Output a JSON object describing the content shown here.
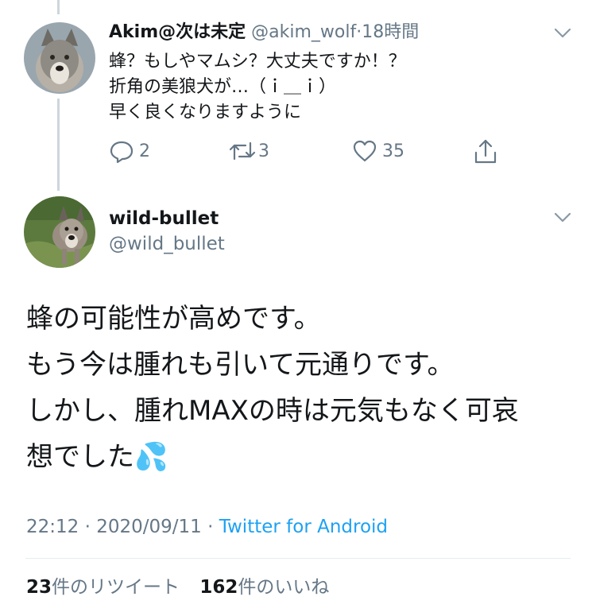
{
  "reply": {
    "display_name": "Akim@次は未定",
    "handle": "@akim_wolf",
    "separator": "·",
    "time": "18時間",
    "lines": [
      "蜂？もしやマムシ？大丈夫ですか！？",
      "折角の美狼犬が…（ｉ＿ｉ）",
      "早く良くなりますように"
    ],
    "actions": {
      "replies": "2",
      "retweets": "3",
      "likes": "35"
    }
  },
  "main_tweet": {
    "display_name": "wild-bullet",
    "handle": "@wild_bullet",
    "lines": [
      "蜂の可能性が高めです。",
      "もう今は腫れも引いて元通りです。",
      "しかし、腫れMAXの時は元気もなく可哀",
      "想でした💦"
    ],
    "meta": {
      "time": "22:12",
      "sep1": " · ",
      "date": "2020/09/11",
      "sep2": " · ",
      "source": "Twitter for Android"
    },
    "stats": {
      "retweet_count": "23",
      "retweet_label": "件のリツイート",
      "like_count": "162",
      "like_label": "件のいいね"
    }
  },
  "colors": {
    "text": "#14171a",
    "muted": "#657786",
    "link": "#1da1f2",
    "thread_line": "#ccd6dd"
  }
}
